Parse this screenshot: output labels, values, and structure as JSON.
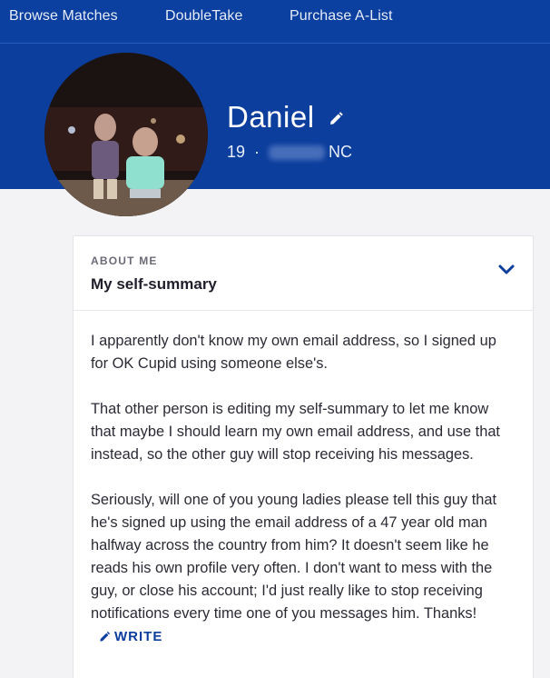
{
  "nav": {
    "items": [
      {
        "label": "Browse Matches"
      },
      {
        "label": "DoubleTake"
      },
      {
        "label": "Purchase A-List"
      }
    ]
  },
  "profile": {
    "name": "Daniel",
    "age": "19",
    "separator": "·",
    "state": "NC",
    "avatar_icon": "profile-photo"
  },
  "about": {
    "label": "ABOUT ME",
    "title": "My self-summary",
    "paragraphs": [
      "I apparently don't know my own email address, so I signed up for OK Cupid using someone else's.",
      "That other person is editing my self-summary to let me know that maybe I should learn my own email address, and use that instead, so the other guy will stop receiving his messages.",
      "Seriously, will one of you young ladies please tell this guy that he's signed up using the email address of a 47 year old man halfway across the country from him? It doesn't seem like he reads his own profile very often. I don't want to mess with the guy, or close his account; I'd just really like to stop receiving notifications every time one of you messages him. Thanks!"
    ],
    "write_label": "WRITE"
  },
  "colors": {
    "brand_blue": "#0c3e9e",
    "nav_blue": "#0b3fa0"
  }
}
